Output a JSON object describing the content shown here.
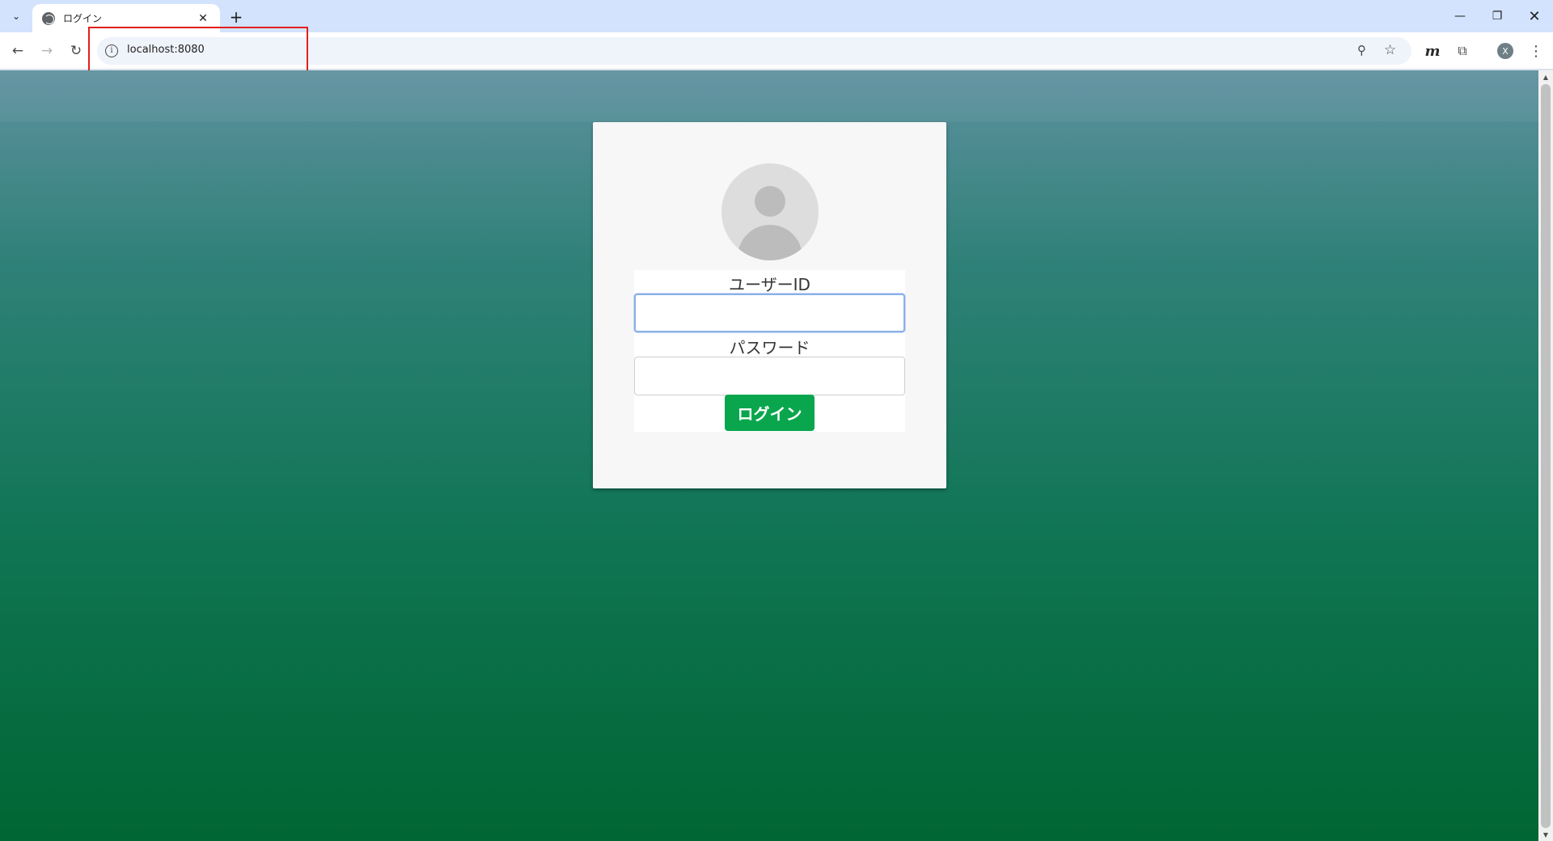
{
  "browser": {
    "tab": {
      "title": "ログイン",
      "close_glyph": "✕"
    },
    "new_tab_glyph": "+",
    "tab_search_glyph": "⌄",
    "window_controls": {
      "minimize": "—",
      "restore": "❐",
      "close": "✕"
    },
    "nav": {
      "back": "←",
      "forward": "→",
      "reload": "↻"
    },
    "address_bar": {
      "info_glyph": "i",
      "url": "localhost:8080"
    },
    "toolbar_icons": {
      "zoom": "⚲",
      "bookmark": "☆",
      "extension_m": "m",
      "extensions": "⧉",
      "profile_initial": "X",
      "menu": "⋮"
    },
    "annotation": {
      "highlight_color": "#e0201b"
    }
  },
  "page": {
    "background_colors": [
      "#5e919f",
      "#2f8178",
      "#107554",
      "#006633"
    ],
    "login_form": {
      "avatar": "user-avatar-icon",
      "userid_label": "ユーザーID",
      "userid_value": "",
      "password_label": "パスワード",
      "password_value": "",
      "submit_label": "ログイン",
      "submit_color": "#0aa64d"
    }
  }
}
